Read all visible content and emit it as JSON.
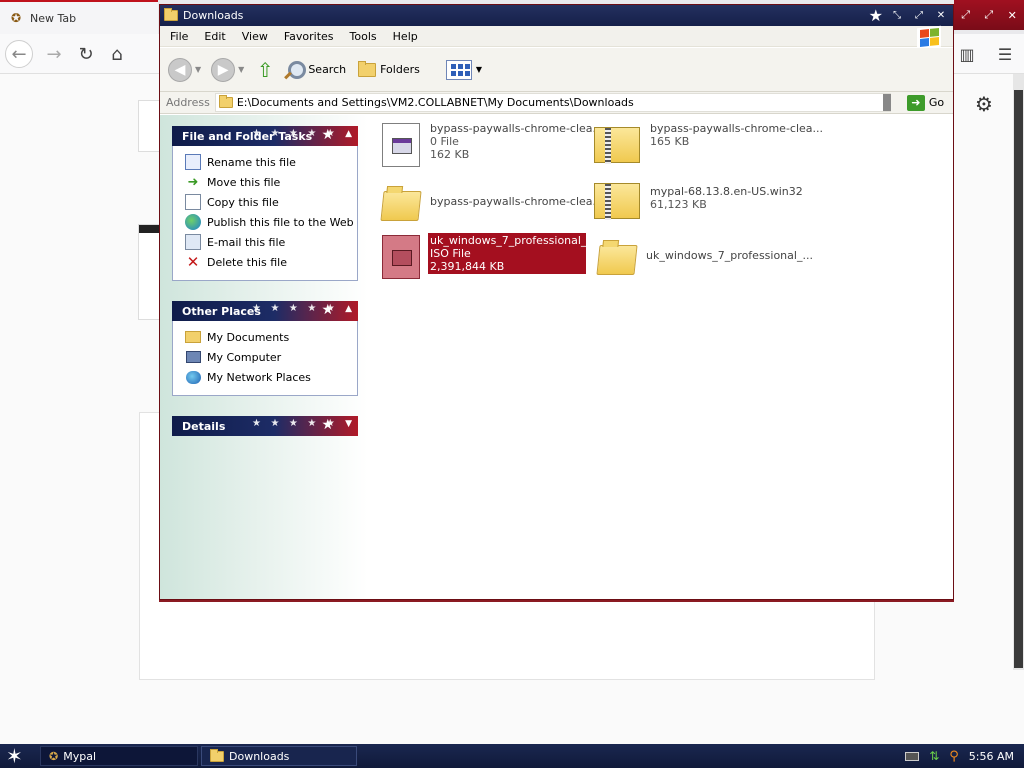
{
  "browser": {
    "tab_title": "New Tab",
    "taskbar_label": "Mypal"
  },
  "explorer": {
    "title": "Downloads",
    "menu": [
      "File",
      "Edit",
      "View",
      "Favorites",
      "Tools",
      "Help"
    ],
    "toolbar": {
      "search_label": "Search",
      "folders_label": "Folders"
    },
    "address": {
      "label": "Address",
      "path": "E:\\Documents and Settings\\VM2.COLLABNET\\My Documents\\Downloads",
      "go_label": "Go"
    },
    "task_pane": {
      "file_tasks": {
        "title": "File and Folder Tasks",
        "items": [
          {
            "label": "Rename this file",
            "icon": "rename-icon"
          },
          {
            "label": "Move this file",
            "icon": "move-icon"
          },
          {
            "label": "Copy this file",
            "icon": "copy-icon"
          },
          {
            "label": "Publish this file to the Web",
            "icon": "web-publish-icon"
          },
          {
            "label": "E-mail this file",
            "icon": "email-icon"
          },
          {
            "label": "Delete this file",
            "icon": "delete-icon"
          }
        ]
      },
      "other_places": {
        "title": "Other Places",
        "items": [
          {
            "label": "My Documents",
            "icon": "folder-icon"
          },
          {
            "label": "My Computer",
            "icon": "computer-icon"
          },
          {
            "label": "My Network Places",
            "icon": "network-icon"
          }
        ]
      },
      "details": {
        "title": "Details"
      }
    },
    "files": [
      {
        "name": "bypass-paywalls-chrome-clea...",
        "type": "0 File",
        "size": "162 KB",
        "icon": "file-icon"
      },
      {
        "name": "bypass-paywalls-chrome-clea...",
        "type": "",
        "size": "165 KB",
        "icon": "zip-folder-icon"
      },
      {
        "name": "bypass-paywalls-chrome-clea...",
        "type": "",
        "size": "",
        "icon": "folder-icon"
      },
      {
        "name": "mypal-68.13.8.en-US.win32",
        "type": "",
        "size": "61,123 KB",
        "icon": "zip-folder-icon"
      },
      {
        "name": "uk_windows_7_professional_...",
        "type": "ISO File",
        "size": "2,391,844 KB",
        "icon": "iso-file-icon",
        "selected": true
      },
      {
        "name": "uk_windows_7_professional_...",
        "type": "",
        "size": "",
        "icon": "folder-icon"
      }
    ]
  },
  "taskbar": {
    "items": [
      "Mypal",
      "Downloads"
    ],
    "clock": "5:56 AM"
  },
  "colors": {
    "title_bar": "#15204a",
    "selection": "#a40f1f",
    "taskbar": "#101a3a"
  }
}
